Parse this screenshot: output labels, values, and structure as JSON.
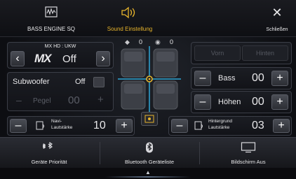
{
  "topbar": {
    "bass_engine_label": "BASS ENGINE SQ",
    "sound_label": "Sound Einstellung",
    "close_label": "Schließen",
    "close_glyph": "✕"
  },
  "source": {
    "band": "MX HD : UKW",
    "logo": "MX",
    "state": "Off",
    "prev": "‹",
    "next": "›"
  },
  "subwoofer": {
    "label": "Subwoofer",
    "state": "Off",
    "pegel_label": "Pegel",
    "pegel_value": "00",
    "minus": "–",
    "plus": "+"
  },
  "balance": {
    "front_rear_value": "0",
    "left_right_value": "0"
  },
  "fader": {
    "front_label": "Vorn",
    "rear_label": "Hinten"
  },
  "bass": {
    "label": "Bass",
    "value": "00",
    "minus": "–",
    "plus": "+"
  },
  "treble": {
    "label": "Höhen",
    "value": "00",
    "minus": "–",
    "plus": "+"
  },
  "navi": {
    "label_line1": "Navi-",
    "label_line2": "Lautstärke",
    "value": "10",
    "minus": "–",
    "plus": "+"
  },
  "background": {
    "label_line1": "Hintergrund",
    "label_line2": "Lautstärke",
    "value": "03",
    "minus": "–",
    "plus": "+"
  },
  "bottombar": {
    "device_priority_label": "Geräte Priorität",
    "bt_list_label": "Bluetooth Geräteliste",
    "screen_off_label": "Bildschirm Aus",
    "handle_glyph": "▲"
  },
  "colors": {
    "accent": "#e8b52c",
    "crosshair": "#2fa7d6"
  }
}
